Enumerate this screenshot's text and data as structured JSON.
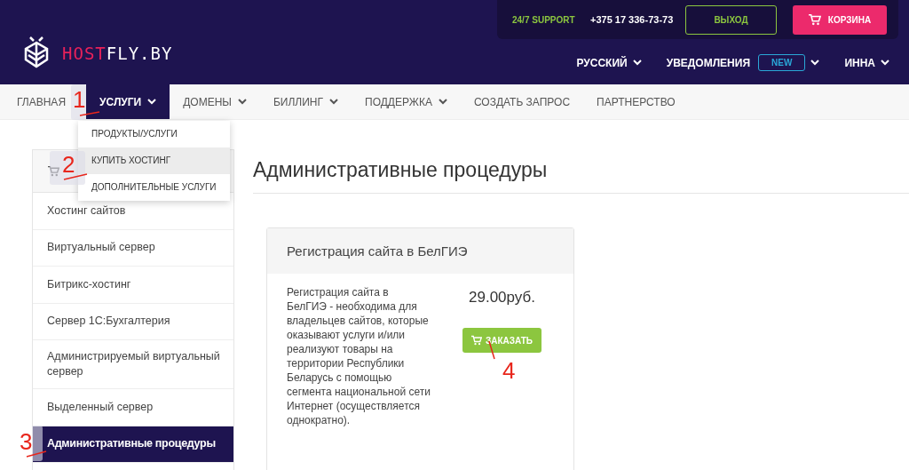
{
  "support": {
    "label": "24/7 SUPPORT",
    "phone": "+375 17 336-73-73",
    "logout": "ВЫХОД",
    "cart": "КОРЗИНА"
  },
  "logo": {
    "accent": "HOST",
    "rest": "FLY.BY"
  },
  "user_menu": [
    {
      "label": "РУССКИЙ"
    },
    {
      "label": "УВЕДОМЛЕНИЯ",
      "badge": "NEW"
    },
    {
      "label": "ИННА"
    }
  ],
  "nav": [
    {
      "label": "ГЛАВНАЯ",
      "selected": false,
      "dropdown": false
    },
    {
      "label": "УСЛУГИ",
      "selected": true,
      "dropdown": true
    },
    {
      "label": "ДОМЕНЫ",
      "selected": false,
      "dropdown": true
    },
    {
      "label": "БИЛЛИНГ",
      "selected": false,
      "dropdown": true
    },
    {
      "label": "ПОДДЕРЖКА",
      "selected": false,
      "dropdown": true
    },
    {
      "label": "СОЗДАТЬ ЗАПРОС",
      "selected": false,
      "dropdown": false
    },
    {
      "label": "ПАРТНЕРСТВО",
      "selected": false,
      "dropdown": false
    }
  ],
  "dropdown": [
    {
      "label": "ПРОДУКТЫ/УСЛУГИ",
      "selected": false
    },
    {
      "label": "КУПИТЬ ХОСТИНГ",
      "selected": true
    },
    {
      "label": "ДОПОЛНИТЕЛЬНЫЕ УСЛУГИ",
      "selected": false
    }
  ],
  "sidebar": {
    "items": [
      {
        "label": "Хостинг сайтов",
        "selected": false
      },
      {
        "label": "Виртуальный сервер",
        "selected": false
      },
      {
        "label": "Битрикс-хостинг",
        "selected": false
      },
      {
        "label": "Сервер 1С:Бухгалтерия",
        "selected": false
      },
      {
        "label": "Администрируемый виртуальный сервер",
        "selected": false
      },
      {
        "label": "Выделенный сервер",
        "selected": false
      },
      {
        "label": "Административные процедуры",
        "selected": true
      }
    ]
  },
  "page_title": "Административные процедуры",
  "product": {
    "title": "Регистрация сайта в БелГИЭ",
    "description": "Регистрация сайта в БелГИЭ - необходима для владельцев сайтов, которые оказывают услуги и/или реализуют товары на территории Республики Беларусь с помощью сегмента национальной сети Интернет (осуществляется однократно).",
    "price": "29.00руб.",
    "order": "ЗАКАЗАТЬ"
  },
  "annotations": [
    {
      "label": "1"
    },
    {
      "label": "2"
    },
    {
      "label": "3"
    },
    {
      "label": "4"
    }
  ]
}
